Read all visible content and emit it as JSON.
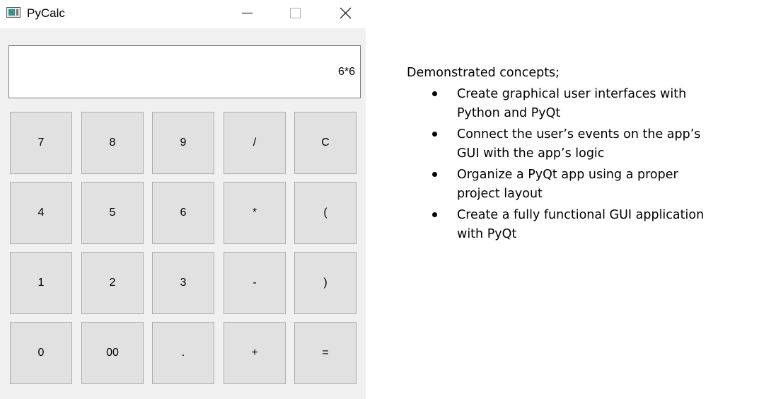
{
  "window": {
    "title": "PyCalc",
    "app_icon": "calculator-app-icon",
    "controls": {
      "minimize_icon": "minimize-icon",
      "maximize_icon": "maximize-icon",
      "close_icon": "close-icon"
    }
  },
  "display": {
    "value": "6*6"
  },
  "keypad": {
    "rows": [
      [
        "7",
        "8",
        "9",
        "/",
        "C"
      ],
      [
        "4",
        "5",
        "6",
        "*",
        "("
      ],
      [
        "1",
        "2",
        "3",
        "-",
        ")"
      ],
      [
        "0",
        "00",
        ".",
        "+",
        "="
      ]
    ]
  },
  "notes": {
    "heading": "Demonstrated concepts;",
    "items": [
      "Create graphical user interfaces with Python and PyQt",
      "Connect the user’s events on the app’s GUI with the app’s logic",
      "Organize a PyQt app using a proper project layout",
      "Create a fully functional GUI application with PyQt"
    ]
  },
  "colors": {
    "window_background": "#f0f0f0",
    "button_background": "#e1e1e1",
    "button_border": "#adadad",
    "display_background": "#ffffff"
  }
}
